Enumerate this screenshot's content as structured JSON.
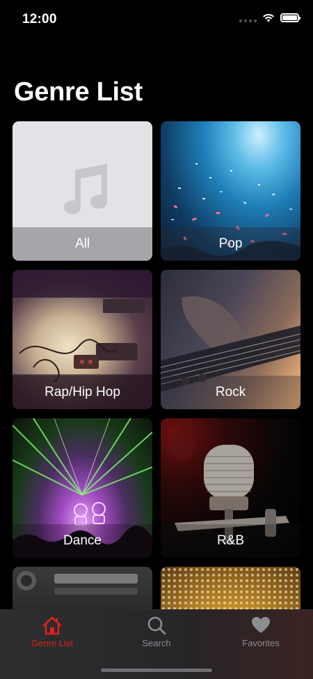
{
  "status_bar": {
    "time": "12:00"
  },
  "page": {
    "title": "Genre List"
  },
  "genres": [
    {
      "label": "All",
      "image": "music-note-placeholder"
    },
    {
      "label": "Pop",
      "image": "confetti-concert-photo"
    },
    {
      "label": "Rap/Hip Hop",
      "image": "turntable-equipment-photo"
    },
    {
      "label": "Rock",
      "image": "electric-guitar-photo"
    },
    {
      "label": "Dance",
      "image": "laser-show-photo"
    },
    {
      "label": "R&B",
      "image": "studio-microphone-photo"
    },
    {
      "label": "",
      "image": "mixing-console-photo"
    },
    {
      "label": "",
      "image": "speaker-grille-lights-photo"
    }
  ],
  "tab_bar": {
    "tabs": [
      {
        "label": "Genre List",
        "icon": "house-icon",
        "active": true
      },
      {
        "label": "Search",
        "icon": "search-icon",
        "active": false
      },
      {
        "label": "Favorites",
        "icon": "heart-icon",
        "active": false
      }
    ]
  },
  "colors": {
    "accent": "#e0201b",
    "inactive_tab": "#8d8d92",
    "background": "#000000"
  }
}
